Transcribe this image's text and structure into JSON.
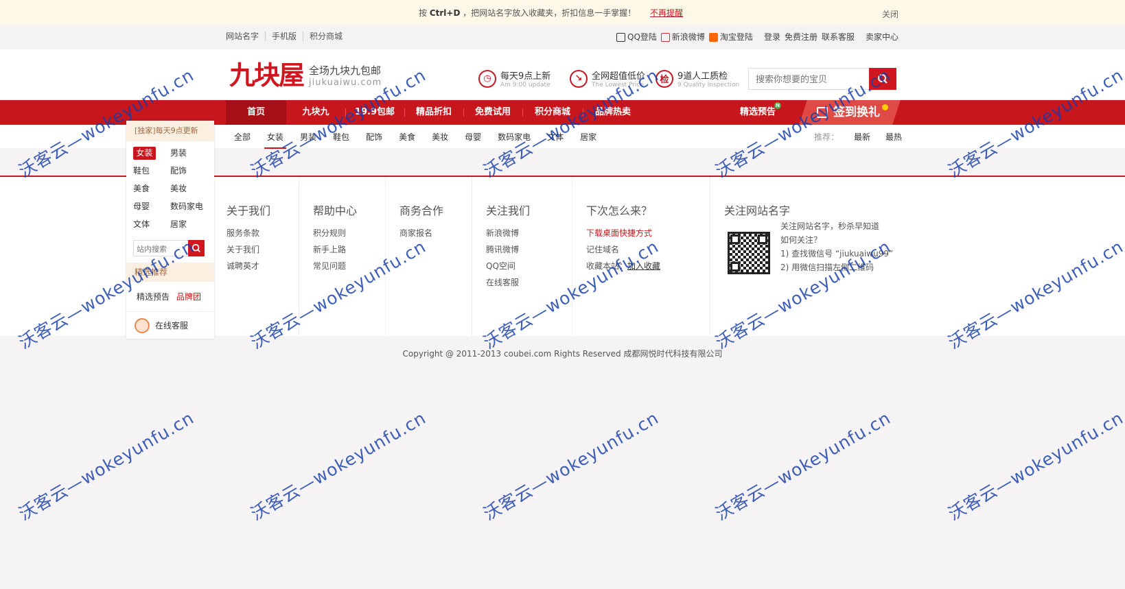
{
  "notice": {
    "prefix": "按 ",
    "keys": "Ctrl+D",
    "text": " ，把网站名字放入收藏夹，折扣信息一手掌握！",
    "dismiss": "不再提醒",
    "close": "关闭"
  },
  "topbar": {
    "left": [
      "网站名字",
      "手机版",
      "积分商城"
    ],
    "right": {
      "qq": "QQ登陆",
      "weibo": "新浪微博",
      "taobao": "淘宝登陆",
      "login": "登录",
      "register": "免费注册",
      "service": "联系客服",
      "seller": "卖家中心"
    }
  },
  "header": {
    "logo": "九块屋",
    "slogan": "全场九块九包邮",
    "domain": "jiukuaiwu.com",
    "features": [
      {
        "icon": "clock-icon",
        "glyph": "◷",
        "title": "每天9点上新",
        "sub": "Am 9:00 update"
      },
      {
        "icon": "trend-icon",
        "glyph": "↘",
        "title": "全网超值低价",
        "sub": "The Lowest Price"
      },
      {
        "icon": "inspect-icon",
        "glyph": "检",
        "title": "9道人工质检",
        "sub": "9 Quality Inspection"
      }
    ],
    "search_placeholder": "搜索你想要的宝贝"
  },
  "nav": {
    "items": [
      "首页",
      "九块九",
      "19.9包邮",
      "精品折扣",
      "免费试用",
      "积分商城",
      "品牌热卖"
    ],
    "preview": "精选预告",
    "preview_badge": "N",
    "sign": "签到换礼"
  },
  "catbar": {
    "cats": [
      "全部",
      "女装",
      "男装",
      "鞋包",
      "配饰",
      "美食",
      "美妆",
      "母婴",
      "数码家电",
      "文体",
      "居家"
    ],
    "active": "女装",
    "rec_label": "推荐：",
    "rec": [
      "最新",
      "最热"
    ]
  },
  "float": {
    "top": "[独家]每天9点更新",
    "cats": [
      "女装",
      "男装",
      "鞋包",
      "配饰",
      "美食",
      "美妆",
      "母婴",
      "数码家电",
      "文体",
      "居家"
    ],
    "search_placeholder": "站内搜索",
    "jx_title": "精选推荐",
    "jx_items": [
      "精选预告",
      "品牌团"
    ],
    "service": "在线客服"
  },
  "footer": {
    "about": {
      "title": "关于我们",
      "items": [
        "服务条款",
        "关于我们",
        "诚聘英才"
      ]
    },
    "help": {
      "title": "帮助中心",
      "items": [
        "积分规则",
        "新手上路",
        "常见问题"
      ]
    },
    "biz": {
      "title": "商务合作",
      "items": [
        "商家报名"
      ]
    },
    "follow": {
      "title": "关注我们",
      "items": [
        "新浪微博",
        "腾讯微博",
        "QQ空间",
        "在线客服"
      ]
    },
    "next": {
      "title": "下次怎么来？",
      "items": [
        "下载桌面快捷方式",
        "记住域名",
        "收藏本站："
      ],
      "add": "加入收藏"
    },
    "site": {
      "title": "关注网站名字",
      "lines": [
        "关注网站名字，秒杀早知道",
        "如何关注？",
        "1) 查找微信号 “jiukuaiwu99”",
        "2) 用微信扫描左侧二维码"
      ]
    }
  },
  "copyright": "Copyright @ 2011-2013 coubei.com Rights Reserved 成都网悦时代科技有限公司",
  "watermark": "沃客云—wokeyunfu.cn",
  "colors": {
    "brand_red": "#c8161d",
    "notice_bg": "#fdf8e8"
  }
}
